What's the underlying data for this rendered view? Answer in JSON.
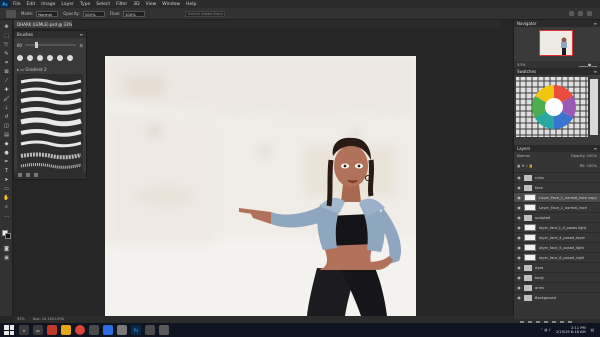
{
  "menu": [
    "File",
    "Edit",
    "Image",
    "Layer",
    "Type",
    "Select",
    "Filter",
    "3D",
    "View",
    "Window",
    "Help"
  ],
  "options": {
    "mode_label": "Mode:",
    "mode_value": "Normal",
    "opacity_label": "Opacity:",
    "opacity_value": "100%",
    "flow_label": "Flow:",
    "flow_value": "100%",
    "search_placeholder": "Search Adobe Stock"
  },
  "document": {
    "tab_title": "DHARK (LEMLE).psd @ 33% (RGB/8) *"
  },
  "brush_panel": {
    "title": "Brushes",
    "size_value": "80",
    "folder_label": "Gradient 2"
  },
  "right_panels": {
    "navigator_title": "Navigator",
    "navigator_zoom": "33%",
    "swatches_title": "Swatches",
    "layers_title": "Layers",
    "layers_mode": "Normal",
    "layers_opacity": "Opacity: 100%",
    "layers_fill": "Fill: 100%"
  },
  "layers": [
    {
      "name": "ruins",
      "kind": "folder",
      "selected": false
    },
    {
      "name": "face",
      "kind": "folder",
      "selected": false
    },
    {
      "name": "Layer_Face_1_normal_face copy",
      "kind": "layer",
      "selected": true
    },
    {
      "name": "Layer_Face_1_normal_face",
      "kind": "layer",
      "selected": false
    },
    {
      "name": "sculpted",
      "kind": "folder",
      "selected": false
    },
    {
      "name": "layer_face_t_4_poses light",
      "kind": "layer",
      "selected": false
    },
    {
      "name": "layer_face_4_posed_layer",
      "kind": "layer",
      "selected": false
    },
    {
      "name": "layer_face_5_posed_light",
      "kind": "layer",
      "selected": false
    },
    {
      "name": "layer_face_6_posed_right",
      "kind": "layer",
      "selected": false
    },
    {
      "name": "eyes",
      "kind": "folder",
      "selected": false
    },
    {
      "name": "body",
      "kind": "folder",
      "selected": false
    },
    {
      "name": "arms",
      "kind": "folder",
      "selected": false
    },
    {
      "name": "Background",
      "kind": "folder",
      "selected": false
    }
  ],
  "status": {
    "zoom": "33%",
    "doc": "Doc: 24.1M/1.09G"
  },
  "taskbar": {
    "time": "2:11 PM",
    "date": "2/19/19 6:18 AM"
  },
  "colors": {
    "accent": "#31a8ff",
    "canvas_bg": "#f4f3f1",
    "jacket": "#8fa6bf",
    "skin": "#b2715a"
  }
}
